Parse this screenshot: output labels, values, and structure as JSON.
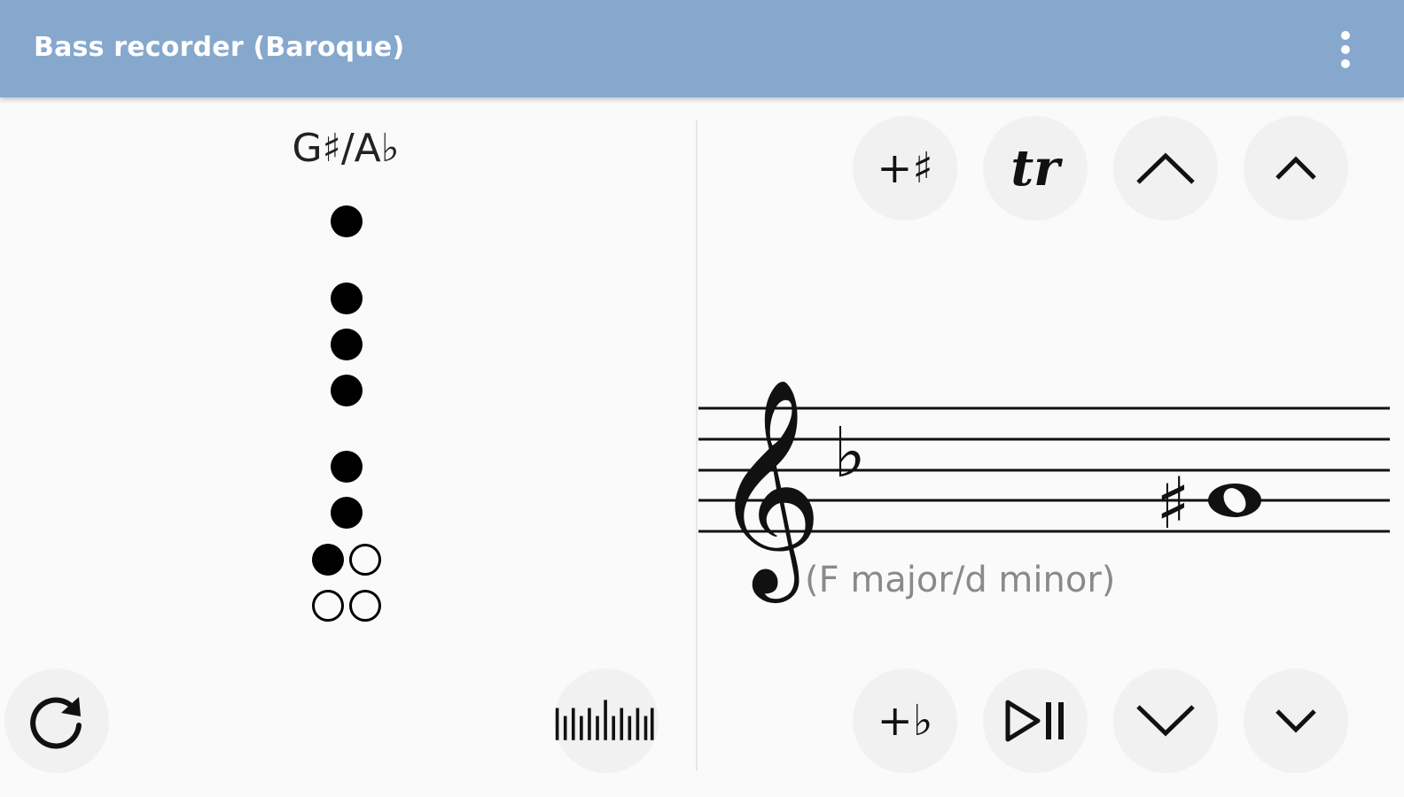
{
  "app": {
    "title": "Bass recorder (Baroque)",
    "menu_icon": "more-vert-icon"
  },
  "fingering": {
    "note_name": "G♯/A♭",
    "holes": [
      {
        "id": "thumb",
        "state": "closed"
      },
      {
        "id": "left-1",
        "state": "closed"
      },
      {
        "id": "left-2",
        "state": "closed"
      },
      {
        "id": "left-3",
        "state": "closed"
      },
      {
        "id": "right-1",
        "state": "closed"
      },
      {
        "id": "right-2",
        "state": "closed"
      },
      {
        "id": "right-3a",
        "state": "closed"
      },
      {
        "id": "right-3b",
        "state": "open"
      },
      {
        "id": "right-4a",
        "state": "open"
      },
      {
        "id": "right-4b",
        "state": "open"
      }
    ]
  },
  "controls": {
    "add_sharp": "+♯",
    "trill": "tr",
    "add_flat": "+♭",
    "icons": {
      "reset": "refresh-icon",
      "tuner": "tuner-icon",
      "octave_up": "chevron-up-icon",
      "semitone_up": "chevron-up-small-icon",
      "play_pause": "play-pause-icon",
      "octave_down": "chevron-down-icon",
      "semitone_down": "chevron-down-small-icon"
    }
  },
  "staff": {
    "clef": "treble",
    "key_signature_symbol": "♭",
    "accidental": "♯",
    "note": "whole note",
    "key_label": "(F major/d minor)"
  }
}
